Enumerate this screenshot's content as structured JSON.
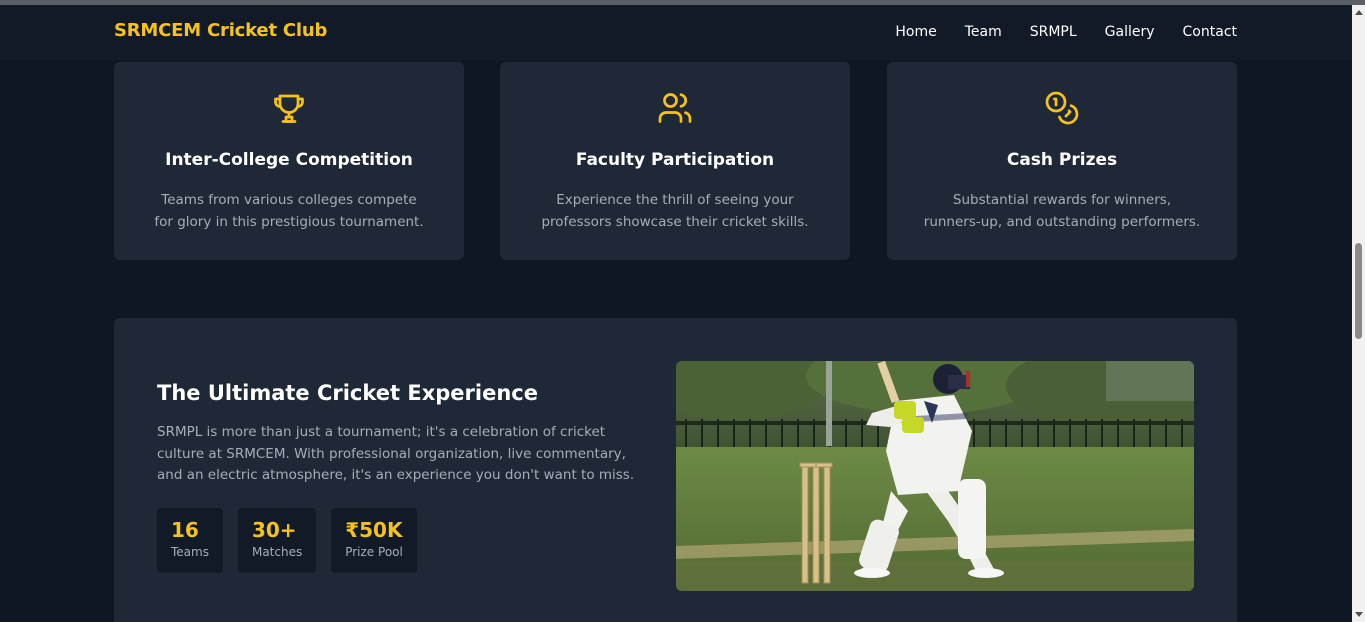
{
  "header": {
    "brand": "SRMCEM Cricket Club",
    "nav": [
      "Home",
      "Team",
      "SRMPL",
      "Gallery",
      "Contact"
    ]
  },
  "features": [
    {
      "icon": "trophy-icon",
      "title": "Inter-College Competition",
      "description": "Teams from various colleges compete for glory in this prestigious tournament."
    },
    {
      "icon": "users-icon",
      "title": "Faculty Participation",
      "description": "Experience the thrill of seeing your professors showcase their cricket skills."
    },
    {
      "icon": "coins-icon",
      "title": "Cash Prizes",
      "description": "Substantial rewards for winners, runners-up, and outstanding performers."
    }
  ],
  "experience": {
    "title": "The Ultimate Cricket Experience",
    "text": "SRMPL is more than just a tournament; it's a celebration of cricket culture at SRMCEM. With professional organization, live commentary, and an electric atmosphere, it's an experience you don't want to miss.",
    "stats": [
      {
        "value": "16",
        "label": "Teams"
      },
      {
        "value": "30+",
        "label": "Matches"
      },
      {
        "value": "₹50K",
        "label": "Prize Pool"
      }
    ],
    "image_subject": "cricket batsman playing a shot at the stumps"
  },
  "colors": {
    "accent": "#f7c21a",
    "background": "#0f1624",
    "card": "#1f2837",
    "muted_text": "#a6adb8"
  }
}
